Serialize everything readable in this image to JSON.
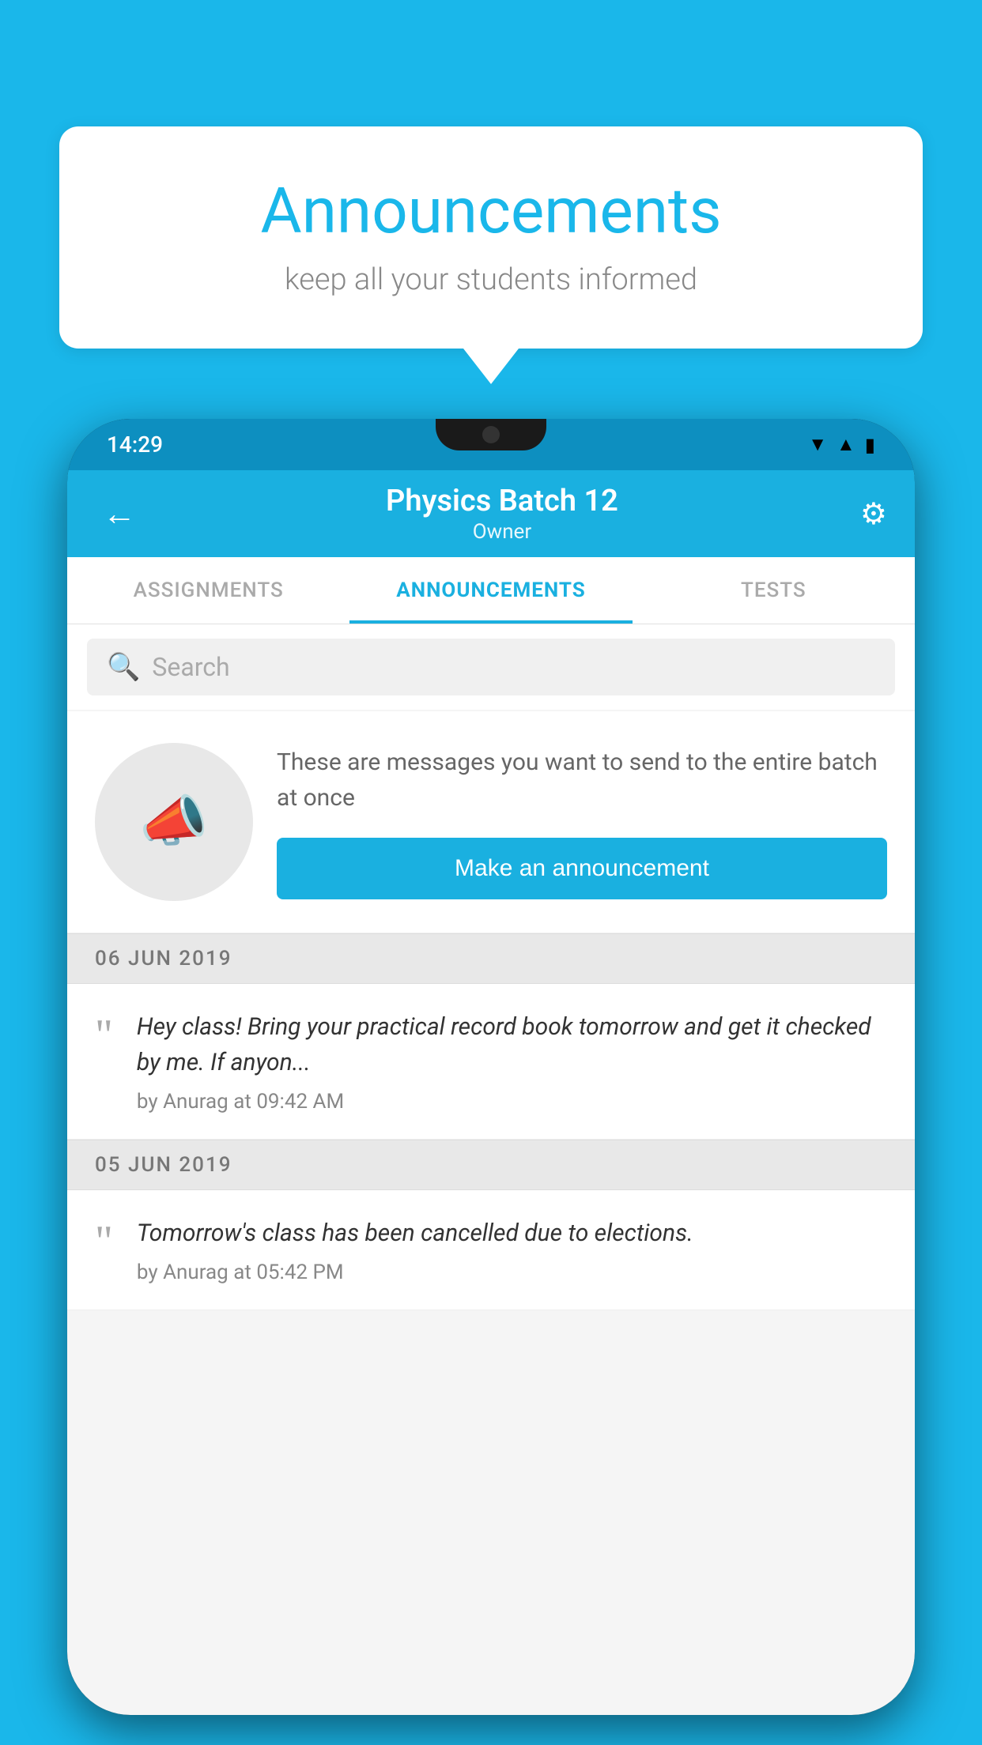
{
  "background_color": "#1ab7ea",
  "speech_bubble": {
    "title": "Announcements",
    "subtitle": "keep all your students informed"
  },
  "phone": {
    "status_bar": {
      "time": "14:29"
    },
    "app_bar": {
      "title": "Physics Batch 12",
      "subtitle": "Owner",
      "back_label": "←",
      "settings_label": "⚙"
    },
    "tabs": [
      {
        "label": "ASSIGNMENTS",
        "active": false
      },
      {
        "label": "ANNOUNCEMENTS",
        "active": true
      },
      {
        "label": "TESTS",
        "active": false
      }
    ],
    "search": {
      "placeholder": "Search"
    },
    "promo": {
      "description": "These are messages you want to send to the entire batch at once",
      "cta_button": "Make an announcement"
    },
    "announcements": [
      {
        "date": "06  JUN  2019",
        "text": "Hey class! Bring your practical record book tomorrow and get it checked by me. If anyon...",
        "author": "by Anurag at 09:42 AM"
      },
      {
        "date": "05  JUN  2019",
        "text": "Tomorrow's class has been cancelled due to elections.",
        "author": "by Anurag at 05:42 PM"
      }
    ]
  }
}
